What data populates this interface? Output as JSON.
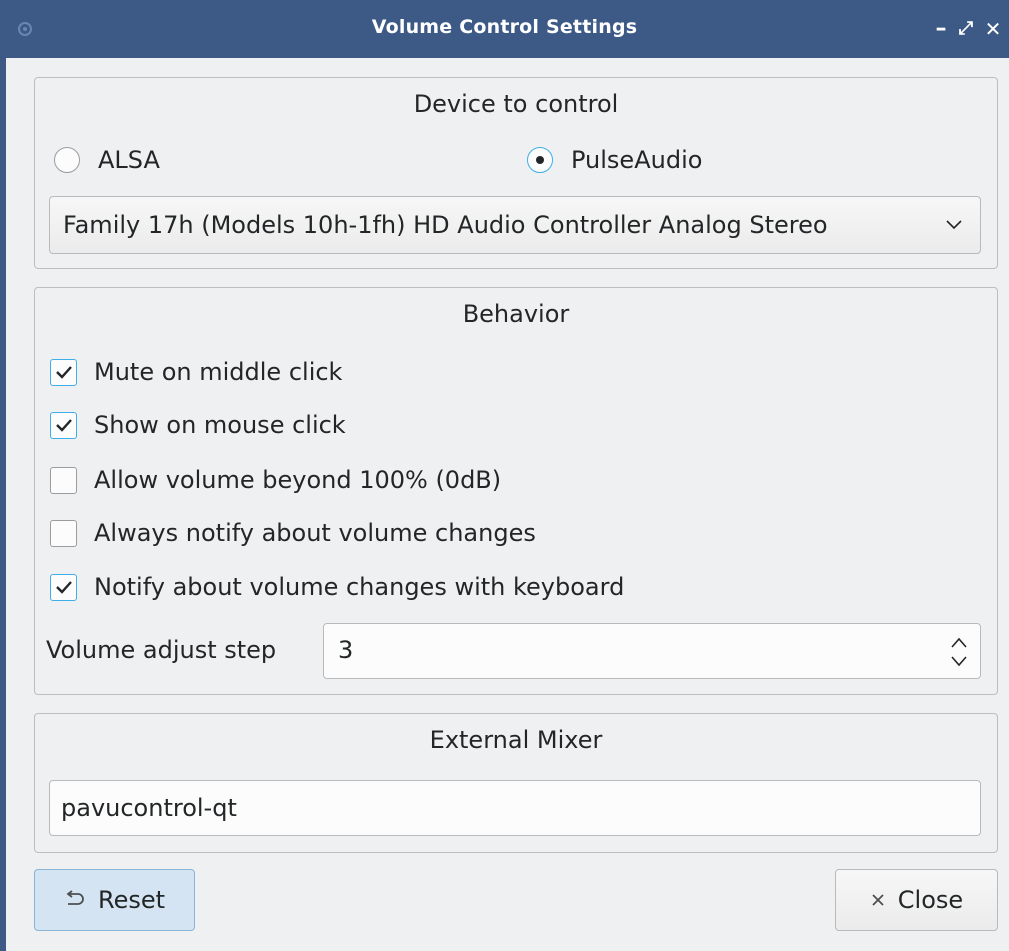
{
  "window": {
    "title": "Volume Control Settings",
    "minimize_glyph": "–",
    "maximize_glyph": "⤢",
    "close_glyph": "✕"
  },
  "device": {
    "title": "Device to control",
    "radio_alsa": "ALSA",
    "radio_pulse": "PulseAudio",
    "selected": "PulseAudio",
    "combo_value": "Family 17h (Models 10h-1fh) HD Audio Controller Analog Stereo"
  },
  "behavior": {
    "title": "Behavior",
    "options": [
      {
        "label": "Mute on middle click",
        "checked": true
      },
      {
        "label": "Show on mouse click",
        "checked": true
      },
      {
        "label": "Allow volume beyond 100% (0dB)",
        "checked": false
      },
      {
        "label": "Always notify about volume changes",
        "checked": false
      },
      {
        "label": "Notify about volume changes with keyboard",
        "checked": true
      }
    ],
    "step_label": "Volume adjust step",
    "step_value": "3"
  },
  "mixer": {
    "title": "External Mixer",
    "value": "pavucontrol-qt"
  },
  "buttons": {
    "reset_label": "Reset",
    "reset_icon": "undo-icon",
    "close_label": "Close",
    "close_icon": "close-icon"
  },
  "colors": {
    "titlebar": "#3d5a87",
    "accent": "#3daee9",
    "background": "#eff0f1"
  }
}
